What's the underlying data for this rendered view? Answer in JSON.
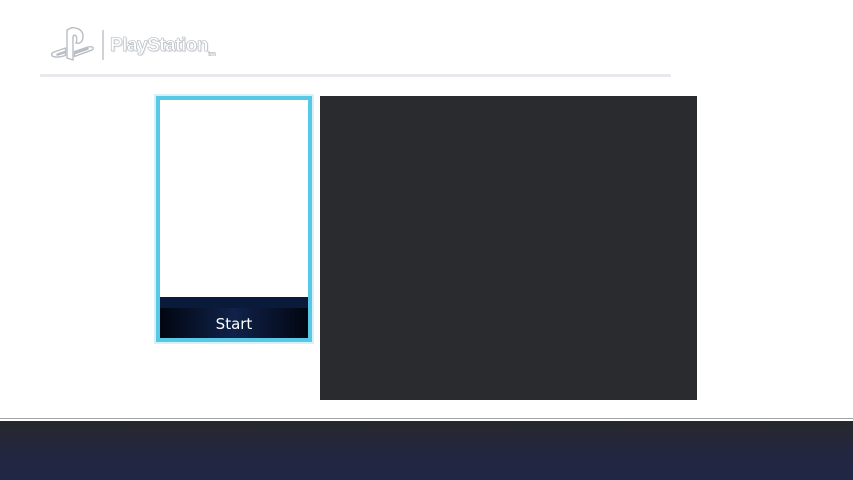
{
  "header": {
    "brand": "PlayStation",
    "brand_mark": "tm",
    "logo_icon": "playstation-symbol-icon"
  },
  "tiles": [
    {
      "label": "Start",
      "selected": true
    }
  ],
  "colors": {
    "selection_highlight": "#57c9e6",
    "tile_caption_bg": "#0a1a3a",
    "preview_bg": "#292b2e",
    "footer_bg": "#202645",
    "page_bg": "#ffffff"
  }
}
